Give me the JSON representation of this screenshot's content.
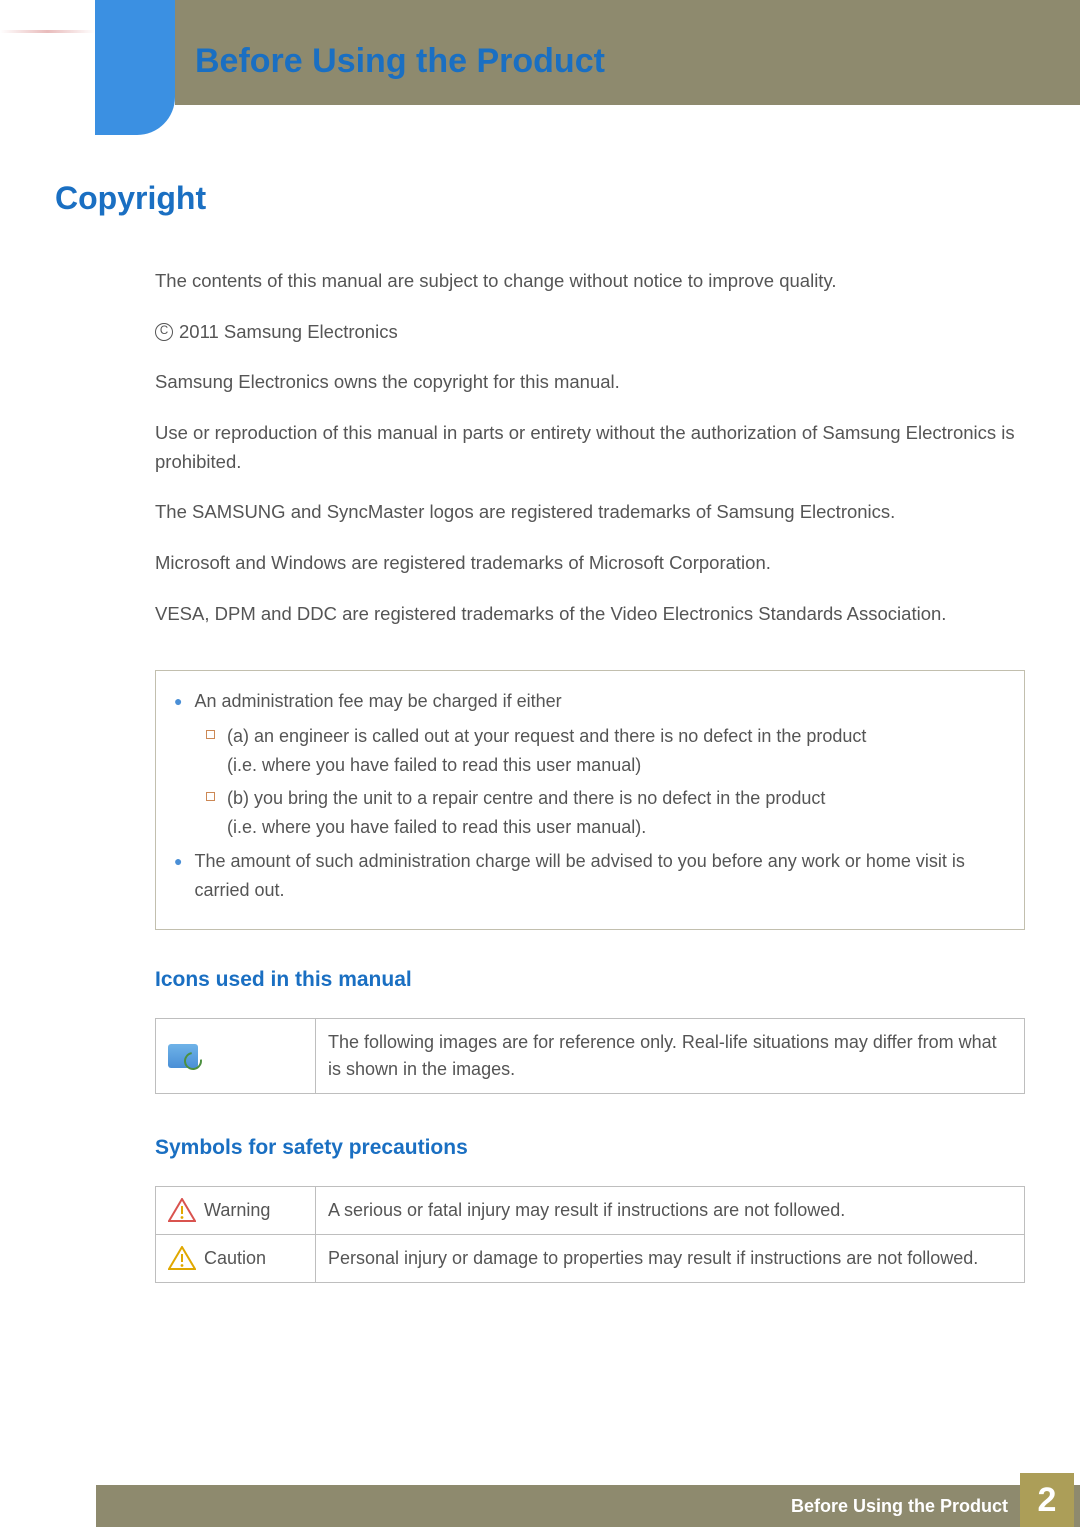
{
  "chapter_title": "Before Using the Product",
  "h1": "Copyright",
  "paragraphs": {
    "p1": "The contents of this manual are subject to change without notice to improve quality.",
    "c_mark": "C",
    "p2": "2011 Samsung Electronics",
    "p3": "Samsung Electronics owns the copyright for this manual.",
    "p4": "Use or reproduction of this manual in parts or entirety without the authorization of Samsung Electronics is prohibited.",
    "p5": "The SAMSUNG and SyncMaster logos are registered trademarks of Samsung Electronics.",
    "p6": "Microsoft and Windows are registered trademarks of Microsoft Corporation.",
    "p7": "VESA, DPM and DDC are registered trademarks of the Video Electronics Standards Association."
  },
  "fee_box": {
    "b1": "An administration fee may be charged if either",
    "s1a": "(a) an engineer is called out at your request and there is no defect in the product",
    "s1b": "(i.e. where you have failed to read this user manual)",
    "s2a": "(b) you bring the unit to a repair centre and there is no defect in the product",
    "s2b": "(i.e. where you have failed to read this user manual).",
    "b2": "The amount of such administration charge will be advised to you before any work or home visit is carried out."
  },
  "h3_icons": "Icons used in this manual",
  "icons_table": {
    "ref_desc": "The following images are for reference only. Real-life situations may differ from what is shown in the images."
  },
  "h3_symbols": "Symbols for safety precautions",
  "symbols_table": {
    "warning_label": "Warning",
    "warning_desc": "A serious or fatal injury may result if instructions are not followed.",
    "caution_label": "Caution",
    "caution_desc": "Personal injury or damage to properties may result if instructions are not followed."
  },
  "footer": {
    "title": "Before Using the Product",
    "page": "2"
  }
}
